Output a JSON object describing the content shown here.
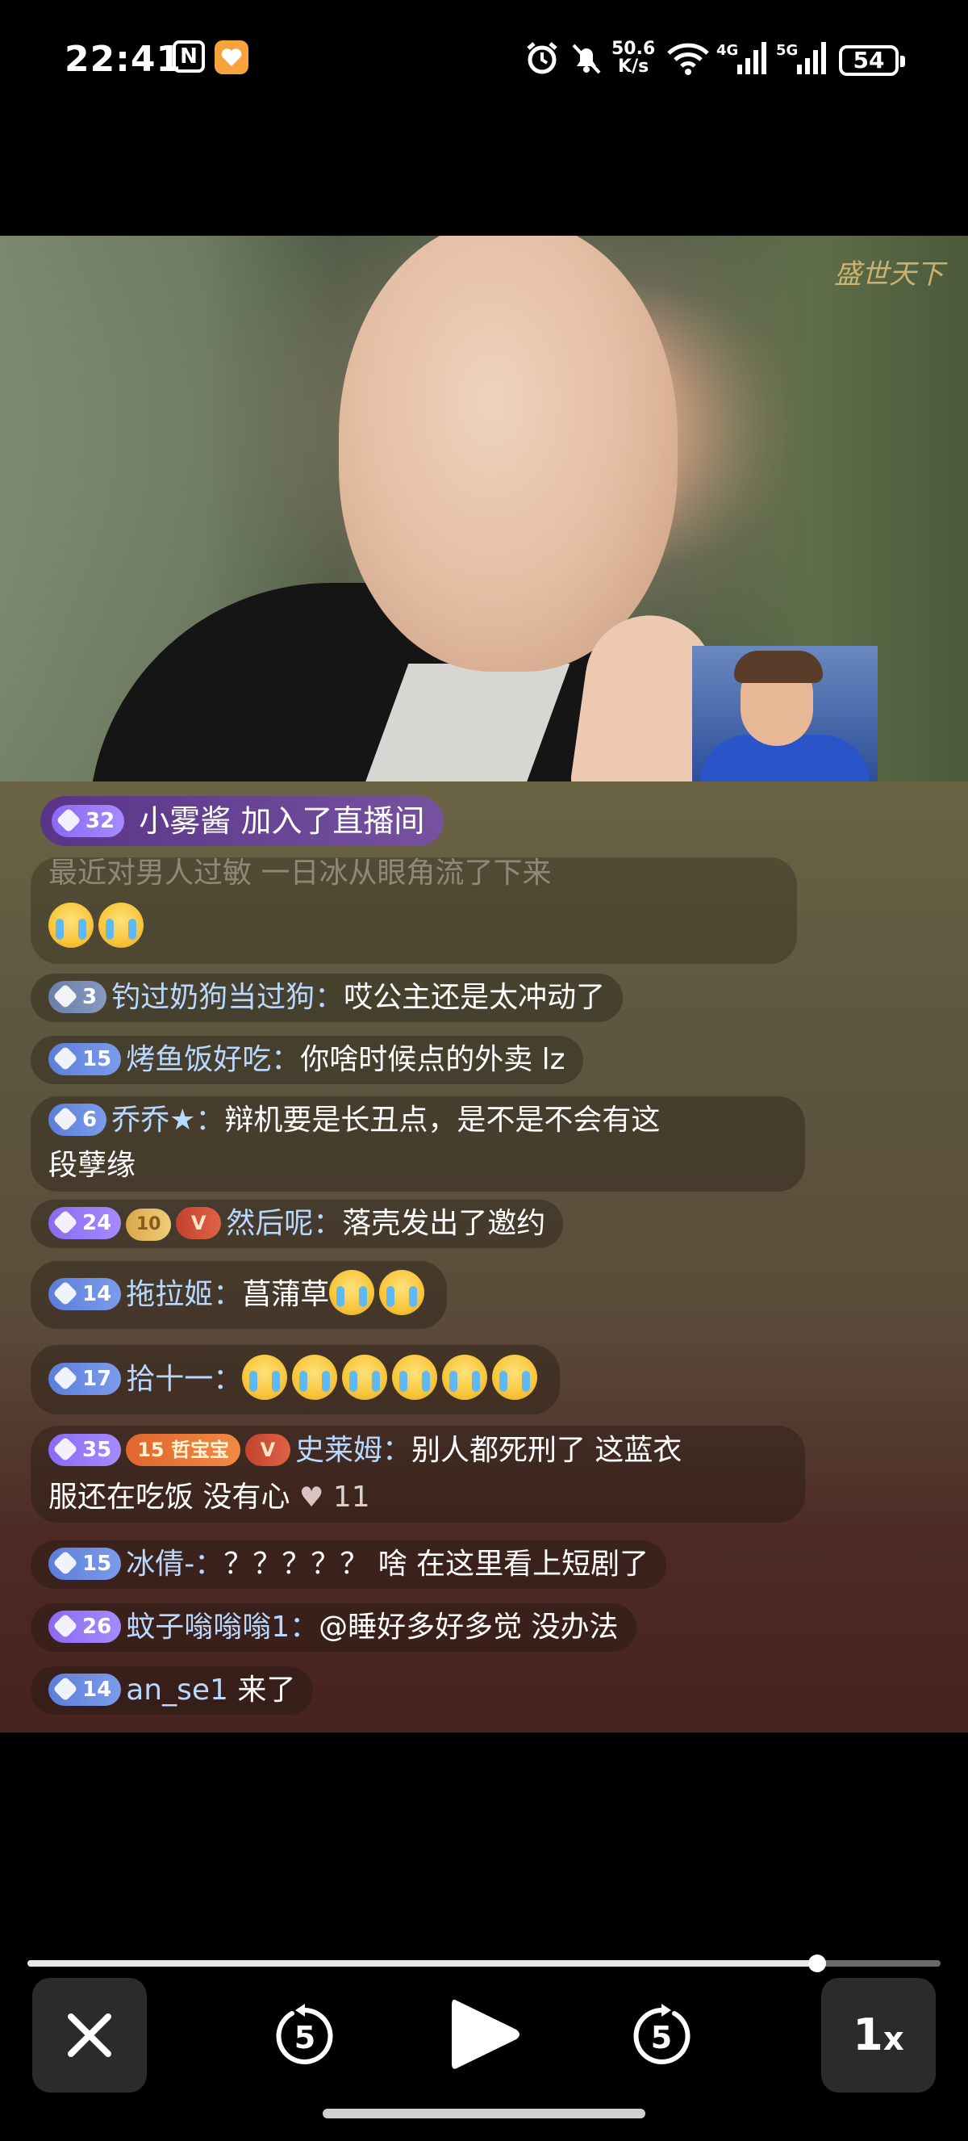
{
  "status_bar": {
    "time": "22:41",
    "nfc_label": "N",
    "net_speed_value": "50.6",
    "net_speed_unit": "K/s",
    "network_4g": "4G",
    "network_5g": "5G",
    "battery": "54",
    "icons": [
      "nfc-icon",
      "app-notification-icon",
      "alarm-icon",
      "mute-icon",
      "wifi-icon",
      "signal-4g-icon",
      "signal-5g-icon",
      "battery-icon"
    ]
  },
  "video": {
    "watermark": "盛世天下",
    "rotate_icon": "rotate-screen-icon"
  },
  "chat": {
    "join_notice": {
      "level": "32",
      "user": "小雾酱",
      "action": "加入了直播间"
    },
    "faded_message": {
      "text": "最近对男人过敏 一日冰从眼角流了下来"
    },
    "messages": [
      {
        "level": "3",
        "user": "钓过奶狗当过狗：",
        "text": "哎公主还是太冲动了"
      },
      {
        "level": "15",
        "user": "烤鱼饭好吃：",
        "text": "你啥时候点的外卖 lz"
      },
      {
        "level": "6",
        "user": "乔乔★：",
        "text": "辩机要是长丑点，是不是不会有这",
        "text2": "段孽缘"
      },
      {
        "level": "24",
        "fan_badge": "10",
        "vip_badge": "V",
        "user": "然后呢：",
        "text": "落壳发出了邀约"
      },
      {
        "level": "14",
        "user": "拖拉姬：",
        "text": "菖蒲草"
      },
      {
        "level": "17",
        "user": "拾十一：",
        "text": ""
      },
      {
        "level": "35",
        "fan_badge": "15 哲宝宝",
        "vip_badge": "V",
        "user": "史莱姆：",
        "text": "别人都死刑了 这蓝衣",
        "text2": "服还在吃饭 没有心",
        "likes": "11"
      },
      {
        "level": "15",
        "user": "冰倩-：",
        "text": "？？？？？ 啥 在这里看上短剧了"
      },
      {
        "level": "26",
        "user": "蚊子嗡嗡嗡1：",
        "text": "@睡好多好多觉 没办法"
      },
      {
        "level": "14",
        "user": "an_se1",
        "text": "来了"
      }
    ]
  },
  "player": {
    "progress": 0.865,
    "rewind_seconds": "5",
    "forward_seconds": "5",
    "speed": "1",
    "speed_suffix": "x"
  }
}
